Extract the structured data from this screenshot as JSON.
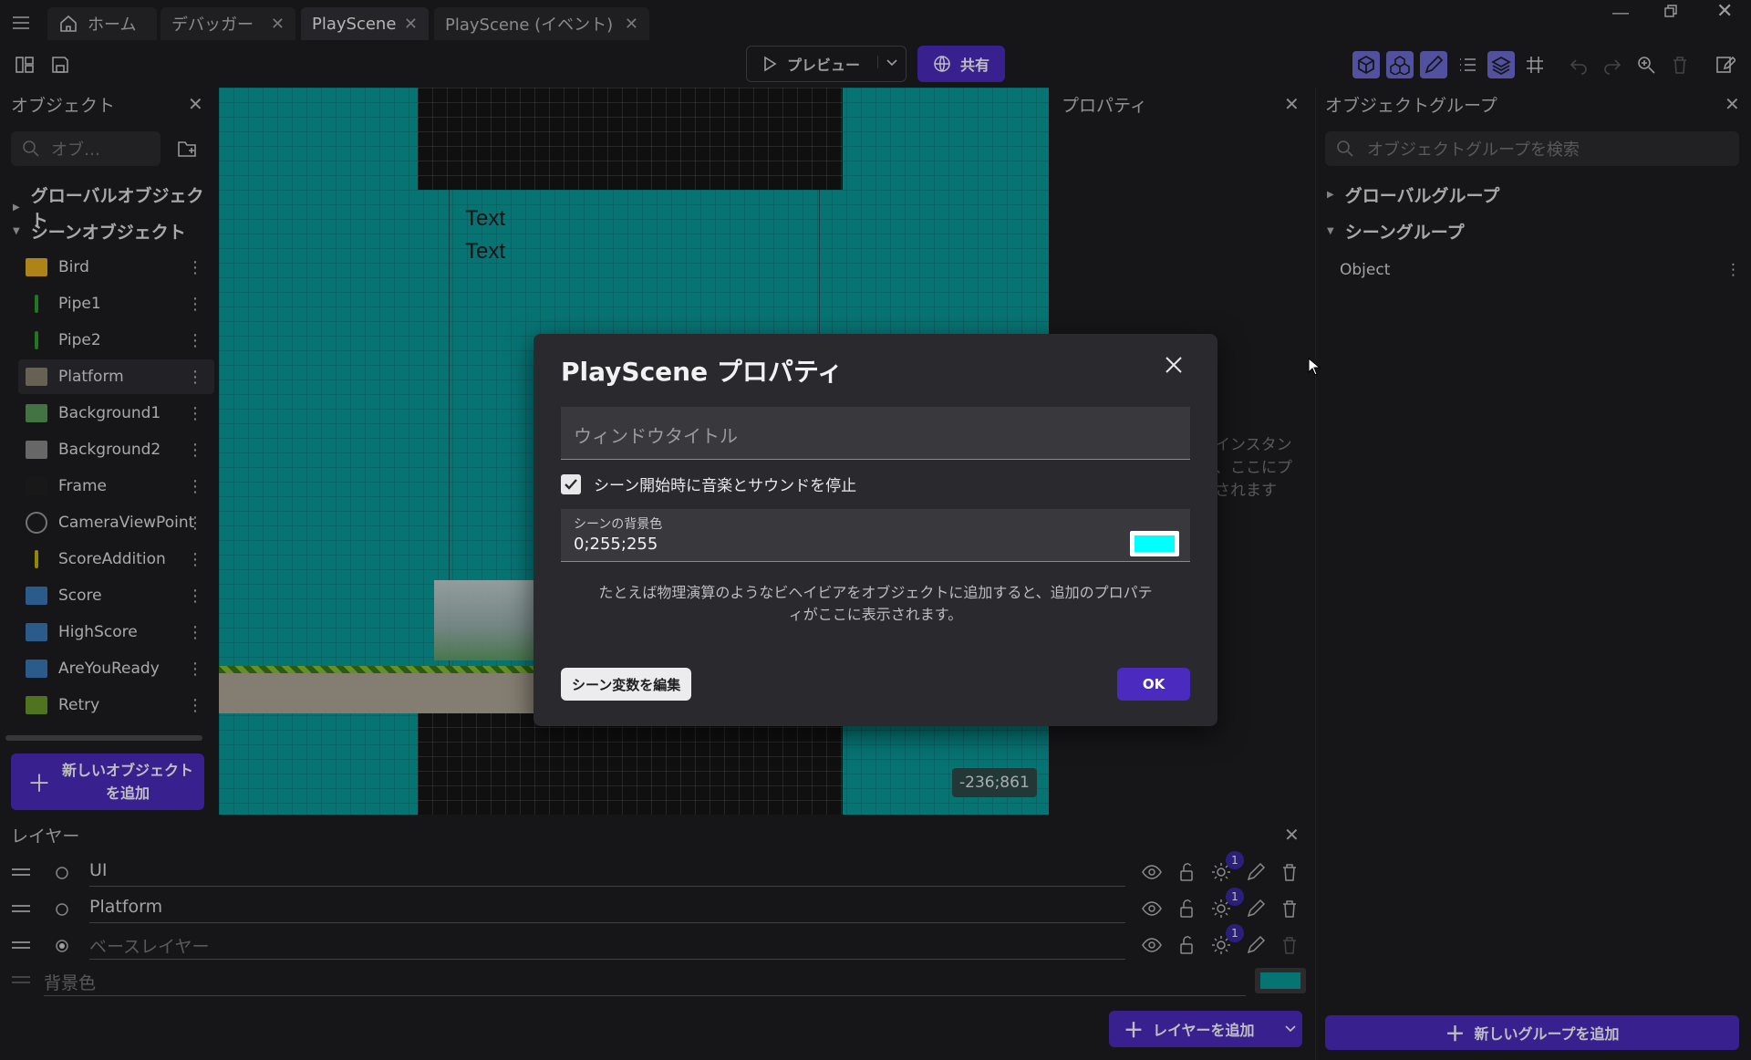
{
  "tabs": [
    {
      "label": "ホーム",
      "icon": "home-icon"
    },
    {
      "label": "デバッガー"
    },
    {
      "label": "PlayScene",
      "active": true
    },
    {
      "label": "PlayScene (イベント)"
    }
  ],
  "toolbar": {
    "preview_label": "プレビュー",
    "share_label": "共有"
  },
  "objects_panel": {
    "title": "オブジェクト",
    "search_placeholder": "オブ…",
    "global_section": "グローバルオブジェクト",
    "scene_section": "シーンオブジェクト",
    "items": [
      {
        "label": "Bird",
        "icon": "bird-thumbnail",
        "color": "#e8b020"
      },
      {
        "label": "Pipe1",
        "icon": "pipe-thumbnail",
        "color": "#2aa02a"
      },
      {
        "label": "Pipe2",
        "icon": "pipe-thumbnail",
        "color": "#2aa02a"
      },
      {
        "label": "Platform",
        "icon": "platform-thumbnail",
        "color": "#8a8270"
      },
      {
        "label": "Background1",
        "icon": "background-thumbnail",
        "color": "#5a9a5a"
      },
      {
        "label": "Background2",
        "icon": "background-thumbnail",
        "color": "#8a8a8a"
      },
      {
        "label": "Frame",
        "icon": "frame-thumbnail",
        "color": "#202020"
      },
      {
        "label": "CameraViewPoint",
        "icon": "crosshair-thumbnail",
        "color": "#9a9a9a"
      },
      {
        "label": "ScoreAddition",
        "icon": "bar-thumbnail",
        "color": "#c8b400"
      },
      {
        "label": "Score",
        "icon": "text-thumbnail",
        "color": "#3a7ab8"
      },
      {
        "label": "HighScore",
        "icon": "text-thumbnail",
        "color": "#3a7ab8"
      },
      {
        "label": "AreYouReady",
        "icon": "text-thumbnail",
        "color": "#3a7ab8"
      },
      {
        "label": "Retry",
        "icon": "retry-thumbnail",
        "color": "#6a9a2a"
      }
    ],
    "add_button_line1": "新しいオブジェクト",
    "add_button_line2": "を追加"
  },
  "canvas": {
    "text1": "Text",
    "text2": "Text",
    "coords": "-236;861",
    "background_color": "#0a9b9b"
  },
  "properties_panel": {
    "title": "プロパティ",
    "hint_line1": "インスタン",
    "hint_line2": "、ここにプ",
    "hint_line3": "されます"
  },
  "groups_panel": {
    "title": "オブジェクトグループ",
    "search_placeholder": "オブジェクトグループを検索",
    "global_section": "グローバルグループ",
    "scene_section": "シーングループ",
    "items": [
      {
        "label": "Object"
      }
    ],
    "add_button": "新しいグループを追加"
  },
  "layers_panel": {
    "title": "レイヤー",
    "layers": [
      {
        "name": "UI",
        "effects": "1",
        "placeholder": false
      },
      {
        "name": "Platform",
        "effects": "1",
        "placeholder": false
      },
      {
        "name": "ベースレイヤー",
        "effects": "1",
        "placeholder": true
      }
    ],
    "background_label": "背景色",
    "background_color": "#0a9b9b",
    "add_layer_button": "レイヤーを追加"
  },
  "modal": {
    "title": "PlayScene プロパティ",
    "window_title_placeholder": "ウィンドウタイトル",
    "stop_sound_label": "シーン開始時に音楽とサウンドを停止",
    "stop_sound_checked": true,
    "bg_color_label": "シーンの背景色",
    "bg_color_value": "0;255;255",
    "bg_color_swatch": "#00ffff",
    "info_line1": "たとえば物理演算のようなビヘイビアをオブジェクトに追加すると、追加のプロパテ",
    "info_line2": "ィがここに表示されます。",
    "edit_vars_button": "シーン変数を編集",
    "ok_button": "OK"
  },
  "colors": {
    "accent": "#4b2bbf",
    "panel_bg": "#1e1e21",
    "modal_bg": "#2a2a2e"
  }
}
